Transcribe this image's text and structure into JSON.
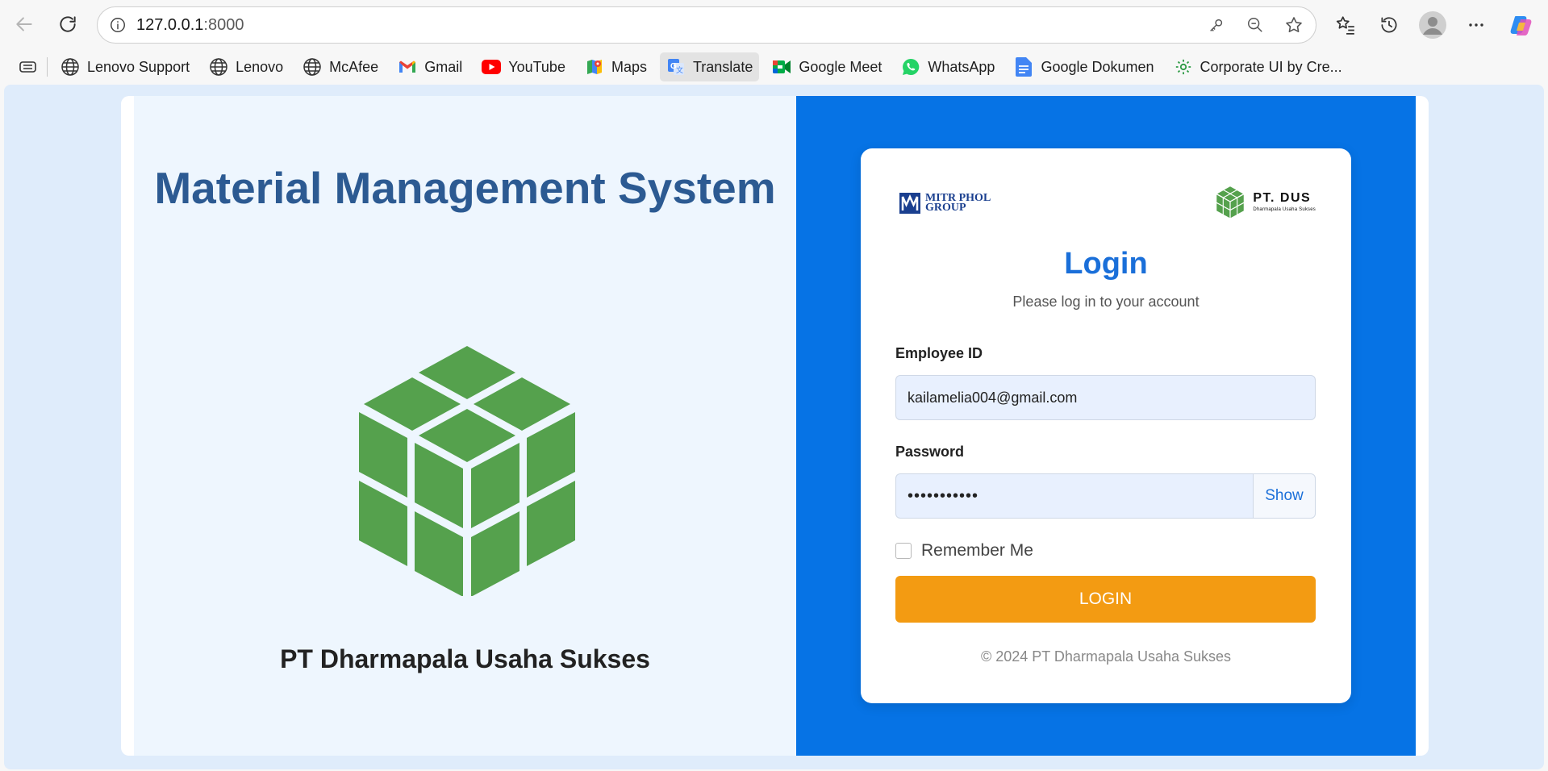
{
  "browser": {
    "url_host": "127.0.0.1",
    "url_port": ":8000",
    "back_icon": "arrow-left-icon",
    "reload_icon": "reload-icon"
  },
  "bookmarks": [
    {
      "label": "Lenovo Support",
      "icon": "globe-icon"
    },
    {
      "label": "Lenovo",
      "icon": "globe-icon"
    },
    {
      "label": "McAfee",
      "icon": "globe-icon"
    },
    {
      "label": "Gmail",
      "icon": "gmail-icon"
    },
    {
      "label": "YouTube",
      "icon": "youtube-icon"
    },
    {
      "label": "Maps",
      "icon": "maps-icon"
    },
    {
      "label": "Translate",
      "icon": "translate-icon"
    },
    {
      "label": "Google Meet",
      "icon": "meet-icon"
    },
    {
      "label": "WhatsApp",
      "icon": "whatsapp-icon"
    },
    {
      "label": "Google Dokumen",
      "icon": "docs-icon"
    },
    {
      "label": "Corporate UI by Cre...",
      "icon": "gear-icon"
    }
  ],
  "left": {
    "title": "Material Management System",
    "company": "PT Dharmapala Usaha Sukses"
  },
  "login": {
    "mitr_logo_line1": "MITR PHOL",
    "mitr_logo_line2": "GROUP",
    "dus_logo_main": "PT. DUS",
    "dus_logo_sub": "Dharmapala Usaha Sukses",
    "title": "Login",
    "subtitle": "Please log in to your account",
    "employee_label": "Employee ID",
    "employee_value": "kailamelia004@gmail.com",
    "password_label": "Password",
    "password_value": "•••••••••••",
    "show_label": "Show",
    "remember_label": "Remember Me",
    "login_button": "LOGIN",
    "copyright": "© 2024 PT Dharmapala Usaha Sukses"
  },
  "colors": {
    "title_blue": "#2c5a92",
    "panel_blue": "#0673e5",
    "button_orange": "#f39b12",
    "cube_green": "#55a14d"
  }
}
